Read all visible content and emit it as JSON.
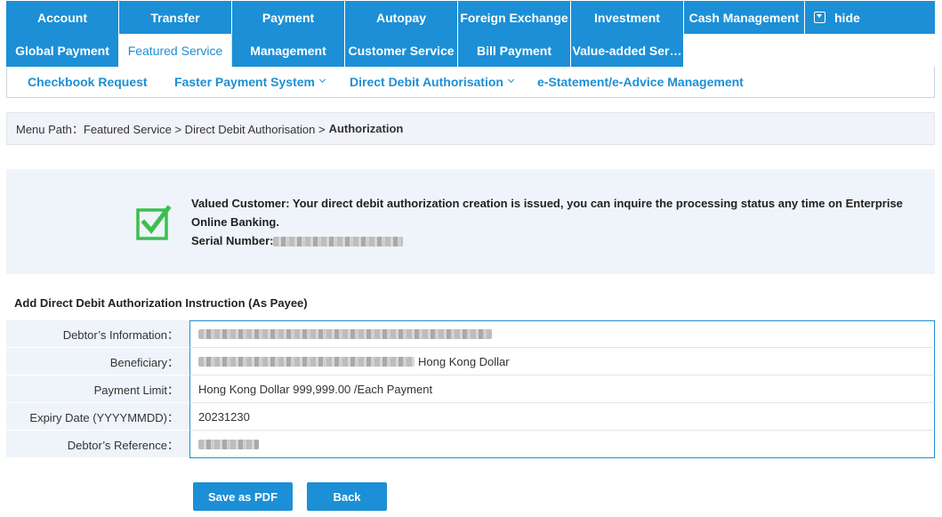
{
  "nav": {
    "row1": [
      {
        "label": "Account"
      },
      {
        "label": "Transfer"
      },
      {
        "label": "Payment"
      },
      {
        "label": "Autopay"
      },
      {
        "label": "Foreign Exchange"
      },
      {
        "label": "Investment"
      },
      {
        "label": "Cash Management"
      }
    ],
    "hide_label": "hide",
    "row2": [
      {
        "label": "Global Payment"
      },
      {
        "label": "Featured Service"
      },
      {
        "label": "Management"
      },
      {
        "label": "Customer Service"
      },
      {
        "label": "Bill Payment"
      },
      {
        "label": "Value-added Ser…"
      }
    ],
    "active": "Featured Service"
  },
  "subnav": [
    {
      "label": "Checkbook Request"
    },
    {
      "label": "Faster Payment System"
    },
    {
      "label": "Direct Debit Authorisation"
    },
    {
      "label": "e-Statement/e-Advice Management"
    }
  ],
  "breadcrumb": {
    "prefix": "Menu Path：Featured Service > Direct Debit Authorisation >",
    "current": "Authorization"
  },
  "success": {
    "message": "Valued Customer: Your direct debit authorization creation is issued, you can inquire the processing status any time on Enterprise Online Banking.",
    "serial_label": "Serial Number:"
  },
  "form": {
    "title": "Add Direct Debit Authorization Instruction (As Payee)",
    "rows": [
      {
        "label": "Debtor’s Information：",
        "value": ""
      },
      {
        "label": "Beneficiary：",
        "value": "Hong Kong Dollar"
      },
      {
        "label": "Payment Limit：",
        "value": "Hong Kong Dollar 999,999.00 /Each Payment"
      },
      {
        "label": "Expiry Date (YYYYMMDD)：",
        "value": "20231230"
      },
      {
        "label": "Debtor’s Reference：",
        "value": ""
      }
    ]
  },
  "buttons": {
    "save_pdf": "Save as PDF",
    "back": "Back"
  },
  "colors": {
    "brand": "#1c8fd6",
    "success_green": "#3cbf4f"
  }
}
